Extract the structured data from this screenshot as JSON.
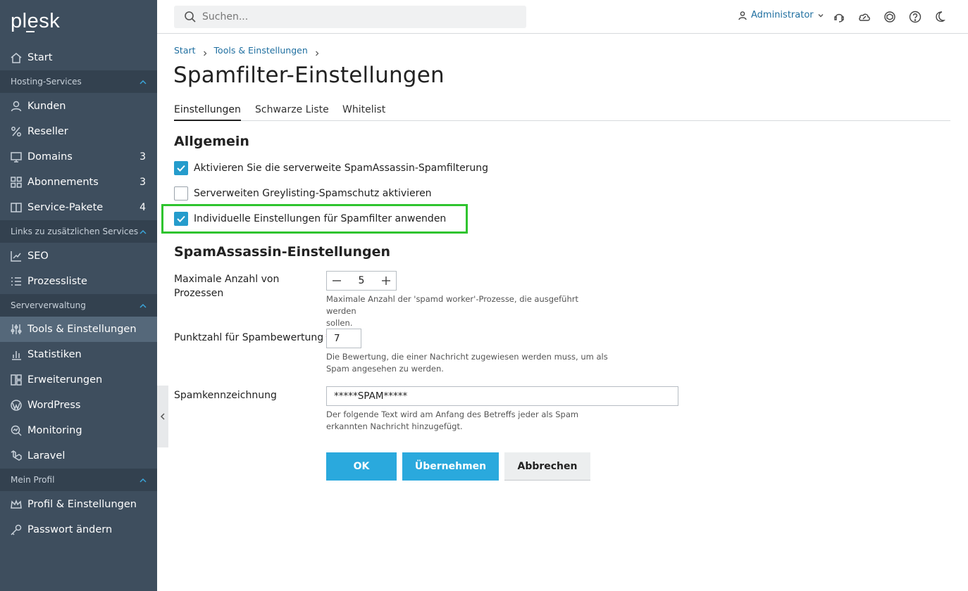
{
  "sidebar": {
    "logo": "plesk",
    "start": "Start",
    "sections": {
      "hosting": "Hosting-Services",
      "links": "Links zu zusätzlichen Services",
      "server": "Serververwaltung",
      "profile": "Mein Profil"
    },
    "items": {
      "kunden": "Kunden",
      "reseller": "Reseller",
      "domains": "Domains",
      "domains_count": "3",
      "abonnements": "Abonnements",
      "abonnements_count": "3",
      "service_pakete": "Service-Pakete",
      "service_pakete_count": "4",
      "seo": "SEO",
      "prozessliste": "Prozessliste",
      "tools": "Tools & Einstellungen",
      "statistiken": "Statistiken",
      "erweiterungen": "Erweiterungen",
      "wordpress": "WordPress",
      "monitoring": "Monitoring",
      "laravel": "Laravel",
      "profil": "Profil & Einstellungen",
      "passwort": "Passwort ändern"
    }
  },
  "topbar": {
    "search_placeholder": "Suchen...",
    "user": "Administrator"
  },
  "breadcrumb": {
    "start": "Start",
    "tools": "Tools & Einstellungen"
  },
  "page": {
    "title": "Spamfilter-Einstellungen",
    "tabs": {
      "settings": "Einstellungen",
      "blacklist": "Schwarze Liste",
      "whitelist": "Whitelist"
    },
    "general": {
      "heading": "Allgemein",
      "enable_spamassassin": "Aktivieren Sie die serverweite SpamAssassin-Spamfilterung",
      "enable_spamassassin_checked": true,
      "greylisting": "Serverweiten Greylisting-Spamschutz aktivieren",
      "greylisting_checked": false,
      "individual": "Individuelle Einstellungen für Spamfilter anwenden",
      "individual_checked": true
    },
    "spamassassin": {
      "heading": "SpamAssassin-Einstellungen",
      "max_processes_label_line1": "Maximale Anzahl von",
      "max_processes_label_line2": "Prozessen",
      "max_processes_value": "5",
      "max_processes_hint_line1": "Maximale Anzahl der 'spamd worker'-Prozesse, die ausgeführt werden",
      "max_processes_hint_line2": "sollen.",
      "score_label": "Punktzahl für Spambewertung",
      "score_required": "*",
      "score_value": "7",
      "score_hint_line1": "Die Bewertung, die einer Nachricht zugewiesen werden muss, um als",
      "score_hint_line2": "Spam angesehen zu werden.",
      "tag_label": "Spamkennzeichnung",
      "tag_value": "*****SPAM*****",
      "tag_hint_line1": "Der folgende Text wird am Anfang des Betreffs jeder als Spam",
      "tag_hint_line2": "erkannten Nachricht hinzugefügt."
    },
    "buttons": {
      "ok": "OK",
      "apply": "Übernehmen",
      "cancel": "Abbrechen"
    }
  },
  "colors": {
    "sidebar_bg": "#3e4e5e",
    "accent": "#2aa9dd",
    "highlight": "#2fc42f"
  }
}
